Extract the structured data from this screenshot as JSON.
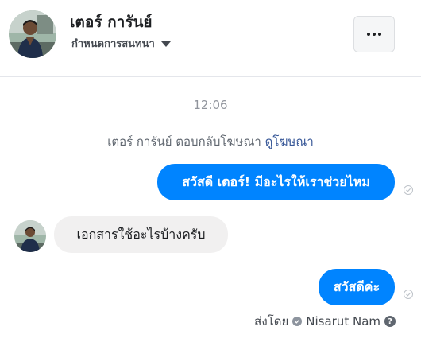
{
  "header": {
    "contact_name": "เตอร์ การันย์",
    "conversation_settings_label": "กำหนดการสนทนา",
    "more_button_icon": "ellipsis-icon"
  },
  "thread": {
    "timestamp": "12:06",
    "reply_note": {
      "text": "เตอร์ การันย์ ตอบกลับโฆษณา",
      "link": "ดูโฆษณา"
    },
    "messages": [
      {
        "direction": "outgoing",
        "text": "สวัสดี เตอร์! มีอะไรให้เราช่วยไหม"
      },
      {
        "direction": "incoming",
        "text": "เอกสารใช้อะไรบ้างครับ"
      },
      {
        "direction": "outgoing",
        "text": "สวัสดีค่ะ"
      }
    ],
    "sent_by": {
      "label": "ส่งโดย",
      "name": "Nisarut Nam"
    }
  },
  "colors": {
    "outgoing_bubble": "#0084ff",
    "incoming_bubble": "#f1f0f0",
    "link": "#385898"
  }
}
